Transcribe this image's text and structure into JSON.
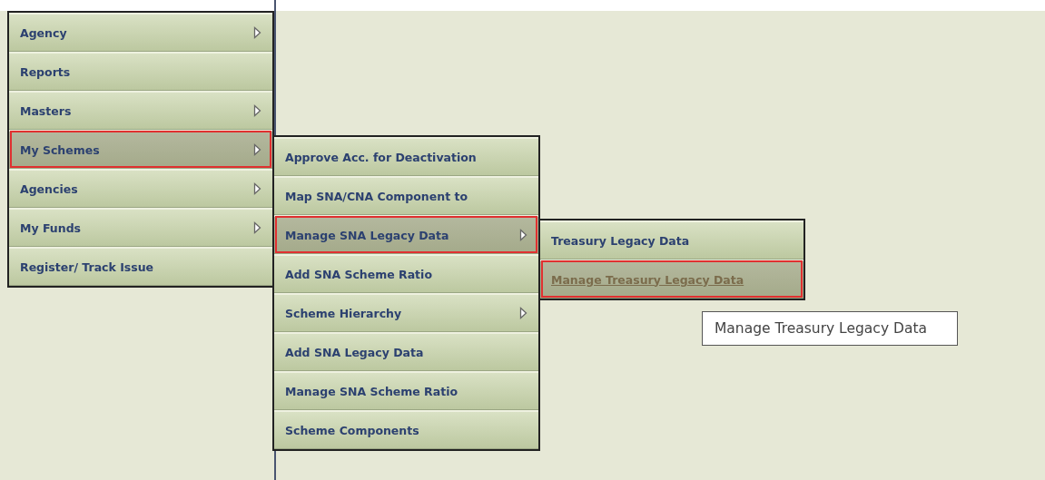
{
  "menu": {
    "items": [
      {
        "label": "Agency",
        "has_submenu": true,
        "selected": false
      },
      {
        "label": "Reports",
        "has_submenu": false,
        "selected": false
      },
      {
        "label": "Masters",
        "has_submenu": true,
        "selected": false
      },
      {
        "label": "My Schemes",
        "has_submenu": true,
        "selected": true
      },
      {
        "label": "Agencies",
        "has_submenu": true,
        "selected": false
      },
      {
        "label": "My Funds",
        "has_submenu": true,
        "selected": false
      },
      {
        "label": "Register/ Track Issue",
        "has_submenu": false,
        "selected": false
      }
    ]
  },
  "submenu": {
    "items": [
      {
        "label": "Approve Acc. for Deactivation",
        "has_submenu": false,
        "selected": false
      },
      {
        "label": "Map SNA/CNA Component to",
        "has_submenu": false,
        "selected": false
      },
      {
        "label": "Manage SNA Legacy Data",
        "has_submenu": true,
        "selected": true
      },
      {
        "label": "Add SNA Scheme Ratio",
        "has_submenu": false,
        "selected": false
      },
      {
        "label": "Scheme Hierarchy",
        "has_submenu": true,
        "selected": false
      },
      {
        "label": "Add SNA Legacy Data",
        "has_submenu": false,
        "selected": false
      },
      {
        "label": "Manage SNA Scheme Ratio",
        "has_submenu": false,
        "selected": false
      },
      {
        "label": "Scheme Components",
        "has_submenu": false,
        "selected": false
      }
    ]
  },
  "sub_submenu": {
    "items": [
      {
        "label": "Treasury Legacy Data",
        "has_submenu": false,
        "selected": false,
        "underlined": false
      },
      {
        "label": "Manage Treasury Legacy Data",
        "has_submenu": false,
        "selected": true,
        "underlined": true
      }
    ]
  },
  "tooltip": {
    "text": "Manage Treasury Legacy Data"
  }
}
